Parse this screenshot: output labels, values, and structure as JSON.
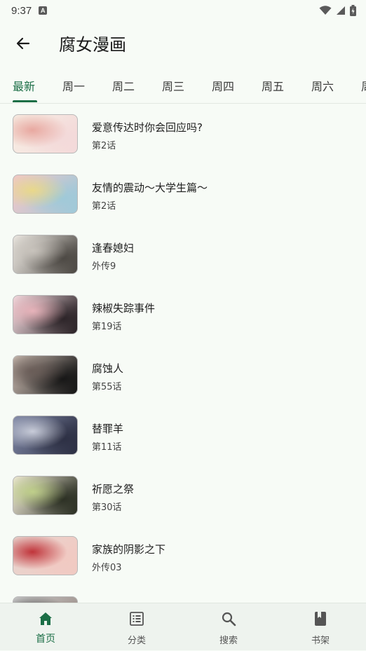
{
  "status_bar": {
    "time": "9:37",
    "notification_badge": "A"
  },
  "app_bar": {
    "title": "腐女漫画",
    "back_icon": "arrow-left-icon"
  },
  "tabs": [
    {
      "label": "最新",
      "active": true
    },
    {
      "label": "周一"
    },
    {
      "label": "周二"
    },
    {
      "label": "周三"
    },
    {
      "label": "周四"
    },
    {
      "label": "周五"
    },
    {
      "label": "周六"
    },
    {
      "label": "周日"
    }
  ],
  "comics": [
    {
      "title": "爱意传达时你会回应吗?",
      "chapter": "第2话",
      "palette": [
        "#f3d9d9",
        "#e8a8a0",
        "#f7eee4"
      ]
    },
    {
      "title": "友情的震动～大学生篇～",
      "chapter": "第2话",
      "palette": [
        "#9ec9d9",
        "#e9d88a",
        "#f2c6c8"
      ]
    },
    {
      "title": "逢春媳妇",
      "chapter": "外传9",
      "palette": [
        "#4b4742",
        "#c8c3bc",
        "#eeeae4"
      ]
    },
    {
      "title": "辣椒失踪事件",
      "chapter": "第19话",
      "palette": [
        "#2a2226",
        "#e7b3ba",
        "#f3dbe0"
      ]
    },
    {
      "title": "腐蚀人",
      "chapter": "第55话",
      "palette": [
        "#151515",
        "#6a5d58",
        "#c9bab0"
      ]
    },
    {
      "title": "替罪羊",
      "chapter": "第11话",
      "palette": [
        "#2c2f43",
        "#c8ccd9",
        "#7e86a4"
      ]
    },
    {
      "title": "祈愿之祭",
      "chapter": "第30话",
      "palette": [
        "#2a2e22",
        "#bfcf8a",
        "#f0ead8"
      ]
    },
    {
      "title": "家族的阴影之下",
      "chapter": "外传03",
      "palette": [
        "#f1c9c2",
        "#c0343a",
        "#e8d5cf"
      ]
    },
    {
      "title": "",
      "chapter": "",
      "palette": [
        "#9a8c86",
        "#555",
        "#ccc"
      ]
    }
  ],
  "bottom_nav": [
    {
      "label": "首页",
      "icon": "home-icon",
      "active": true
    },
    {
      "label": "分类",
      "icon": "list-icon"
    },
    {
      "label": "搜索",
      "icon": "search-icon"
    },
    {
      "label": "书架",
      "icon": "bookshelf-icon"
    }
  ],
  "colors": {
    "accent": "#1b6e46",
    "background": "#f7fbf6"
  }
}
